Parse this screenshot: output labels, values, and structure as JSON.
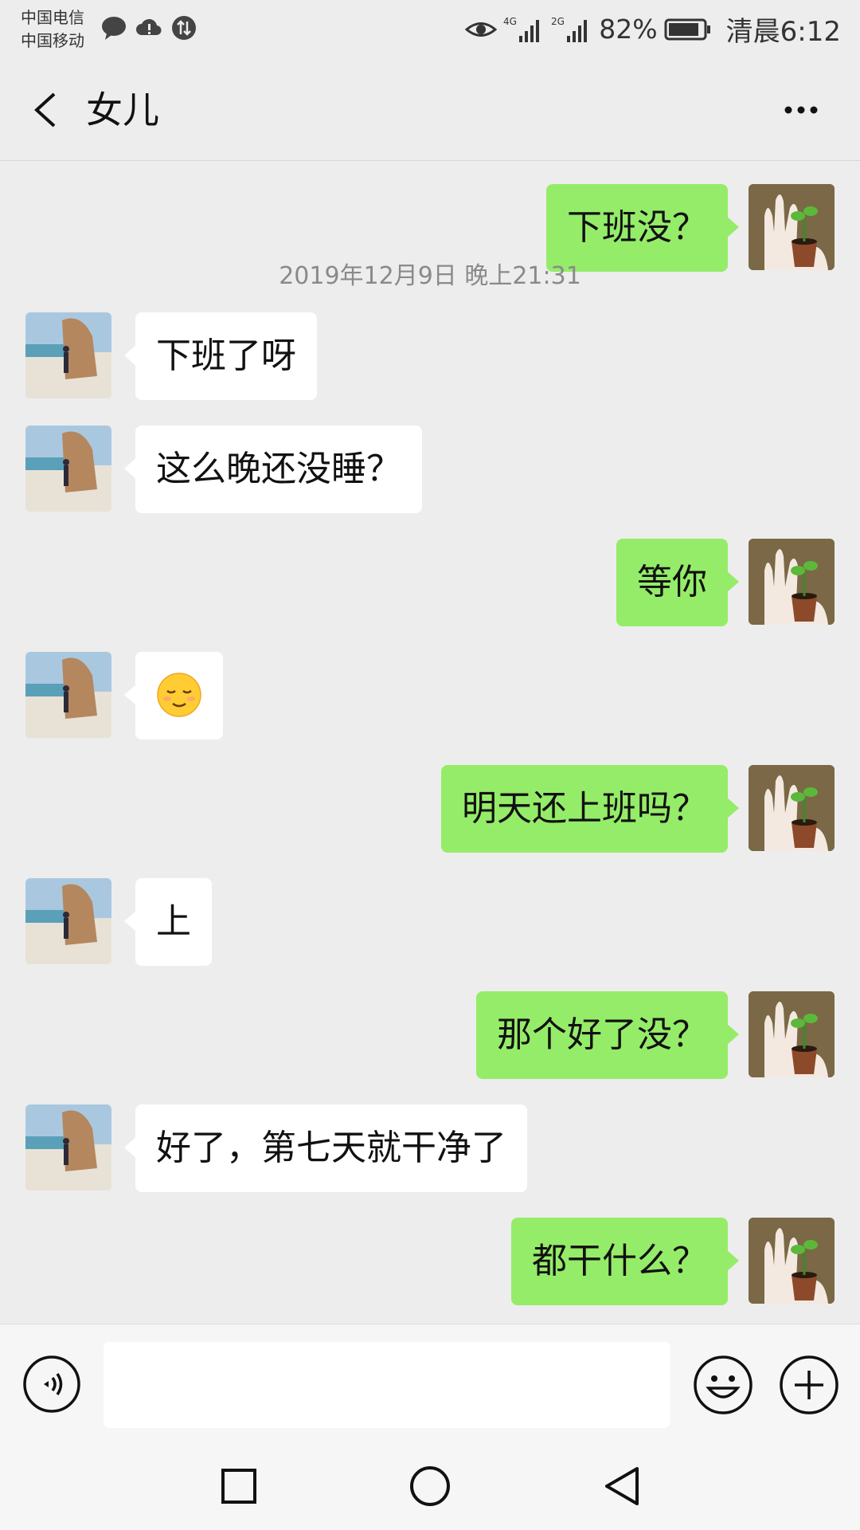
{
  "status_bar": {
    "carrier_1": "中国电信",
    "carrier_2": "中国移动",
    "network_1": "4G",
    "network_2": "2G",
    "battery_percent": "82%",
    "time": "清晨6:12"
  },
  "header": {
    "title": "女儿",
    "more_label": "···"
  },
  "chat": {
    "messages": [
      {
        "side": "me",
        "text": "下班没？"
      },
      {
        "side": "timestamp",
        "text": "2019年12月9日 晚上21:31"
      },
      {
        "side": "them",
        "text": "下班了呀"
      },
      {
        "side": "them",
        "text": "这么晚还没睡？"
      },
      {
        "side": "me",
        "text": "等你"
      },
      {
        "side": "them",
        "text": "",
        "emoji": "relieved-face"
      },
      {
        "side": "me",
        "text": "明天还上班吗？"
      },
      {
        "side": "them",
        "text": "上"
      },
      {
        "side": "me",
        "text": "那个好了没？"
      },
      {
        "side": "them",
        "text": "好了，第七天就干净了"
      },
      {
        "side": "me",
        "text": "都干什么？"
      }
    ]
  },
  "input_bar": {
    "placeholder": "",
    "voice_icon": "voice-icon",
    "emoji_icon": "emoji-icon",
    "plus_icon": "plus-icon"
  },
  "nav_bar": {
    "icons": [
      "recents-square-icon",
      "home-circle-icon",
      "back-triangle-icon"
    ]
  },
  "colors": {
    "background": "#ededed",
    "my_bubble": "#95ec69",
    "their_bubble": "#ffffff"
  }
}
